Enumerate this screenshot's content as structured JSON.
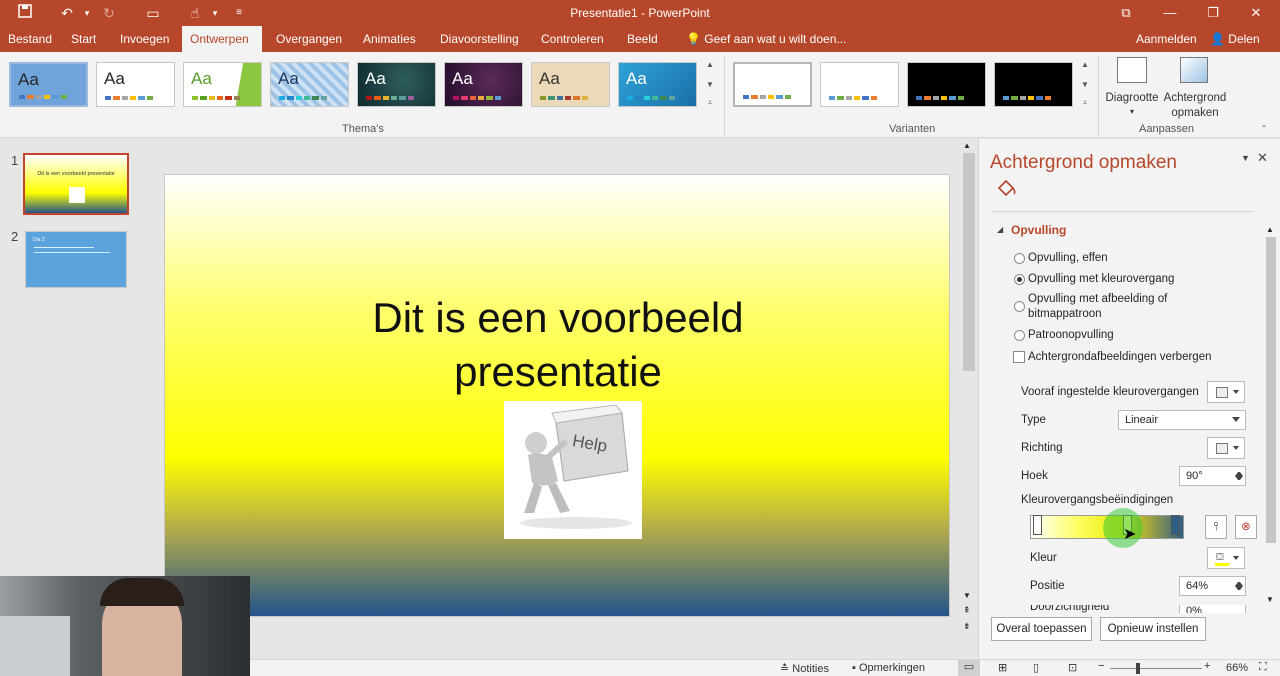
{
  "window": {
    "title": "Presentatie1 - PowerPoint"
  },
  "tabs": [
    {
      "label": "Bestand"
    },
    {
      "label": "Start"
    },
    {
      "label": "Invoegen"
    },
    {
      "label": "Ontwerpen"
    },
    {
      "label": "Overgangen"
    },
    {
      "label": "Animaties"
    },
    {
      "label": "Diavoorstelling"
    },
    {
      "label": "Controleren"
    },
    {
      "label": "Beeld"
    }
  ],
  "tell_me": "Geef aan wat u wilt doen...",
  "account": {
    "signin": "Aanmelden",
    "share": "Delen"
  },
  "ribbon": {
    "themes_label": "Thema's",
    "variants_label": "Varianten",
    "customize_label": "Aanpassen",
    "theme_text": "Aa",
    "slide_size": "Diagrootte",
    "format_background_line1": "Achtergrond",
    "format_background_line2": "opmaken"
  },
  "thumbnails": [
    {
      "number": "1",
      "title": "Dit is een voorbeeld presentatie"
    },
    {
      "number": "2",
      "title": "Dia 2"
    }
  ],
  "slide": {
    "title_line1": "Dit is een voorbeeld",
    "title_line2": "presentatie",
    "image_text": "Help"
  },
  "pane": {
    "title": "Achtergrond opmaken",
    "section": "Opvulling",
    "options": [
      {
        "label": "Opvulling, effen",
        "selected": false
      },
      {
        "label": "Opvulling met kleurovergang",
        "selected": true
      },
      {
        "label": "Opvulling met afbeelding of",
        "label2": "bitmappatroon",
        "selected": false
      },
      {
        "label": "Patroonopvulling",
        "selected": false
      }
    ],
    "hide_bg_graphics": "Achtergrondafbeeldingen verbergen",
    "preset_label": "Vooraf ingestelde kleurovergangen",
    "type_label": "Type",
    "type_value": "Lineair",
    "direction_label": "Richting",
    "angle_label": "Hoek",
    "angle_value": "90°",
    "stops_label": "Kleurovergangsbeëindigingen",
    "color_label": "Kleur",
    "position_label": "Positie",
    "position_value": "64%",
    "transparency_label": "Doorzichtigheid",
    "transparency_value": "0%",
    "apply_all": "Overal toepassen",
    "reset": "Opnieuw instellen"
  },
  "status": {
    "notes": "Notities",
    "comments": "Opmerkingen",
    "zoom": "66%"
  },
  "colors": {
    "accent": "#b7472a",
    "ribbon_bg": "#f3f3f3"
  }
}
